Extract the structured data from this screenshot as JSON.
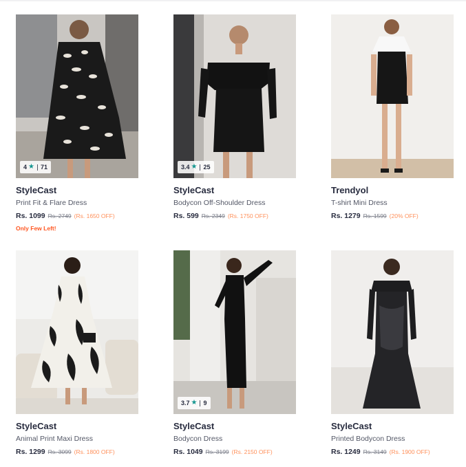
{
  "products": [
    {
      "brand": "StyleCast",
      "name": "Print Fit & Flare Dress",
      "price": "Rs. 1099",
      "mrp": "Rs. 2749",
      "discount": "(Rs. 1650 OFF)",
      "rating": {
        "value": "4",
        "count": "71"
      },
      "stock_note": "Only Few Left!"
    },
    {
      "brand": "StyleCast",
      "name": "Bodycon Off-Shoulder Dress",
      "price": "Rs. 599",
      "mrp": "Rs. 2349",
      "discount": "(Rs. 1750 OFF)",
      "rating": {
        "value": "3.4",
        "count": "25"
      }
    },
    {
      "brand": "Trendyol",
      "name": "T-shirt Mini Dress",
      "price": "Rs. 1279",
      "mrp": "Rs. 1599",
      "discount": "(20% OFF)"
    },
    {
      "brand": "StyleCast",
      "name": "Animal Print Maxi Dress",
      "price": "Rs. 1299",
      "mrp": "Rs. 3099",
      "discount": "(Rs. 1800 OFF)"
    },
    {
      "brand": "StyleCast",
      "name": "Bodycon Dress",
      "price": "Rs. 1049",
      "mrp": "Rs. 3199",
      "discount": "(Rs. 2150 OFF)",
      "rating": {
        "value": "3.7",
        "count": "9"
      }
    },
    {
      "brand": "StyleCast",
      "name": "Printed Bodycon Dress",
      "price": "Rs. 1249",
      "mrp": "Rs. 3149",
      "discount": "(Rs. 1900 OFF)"
    }
  ],
  "icons": {
    "rating_star": "star-icon"
  },
  "colors": {
    "rating_star": "#14958f",
    "discount": "#ff905a",
    "stock_note": "#ff5722"
  }
}
